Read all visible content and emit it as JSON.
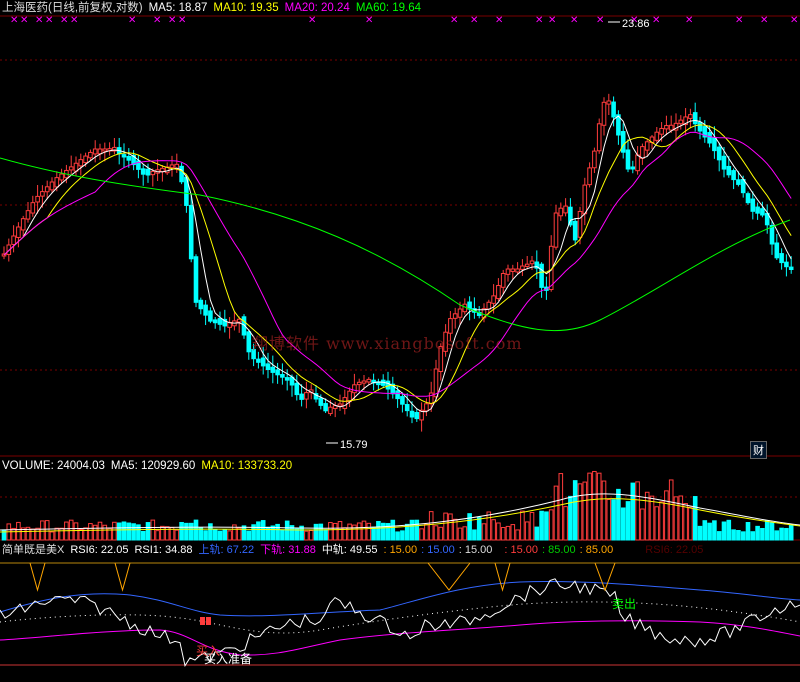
{
  "main_legend": {
    "title": "上海医药(日线,前复权,对数)",
    "ma5": "MA5: 18.87",
    "ma10": "MA10: 19.35",
    "ma20": "MA20: 20.24",
    "ma60": "MA60: 19.64"
  },
  "price_marks": {
    "high": "23.86",
    "low": "15.79"
  },
  "watermark": "翔博软件 www.xiangbosoft.com",
  "finance_tag": "财",
  "volume_legend": {
    "volume": "VOLUME: 24004.03",
    "ma5": "MA5: 120929.60",
    "ma10": "MA10: 133733.20"
  },
  "indicator_legend": {
    "name": "简单既是美X",
    "rsi6": "RSI6: 22.05",
    "rsi1": "RSI1: 34.88",
    "upper": "上轨: 67.22",
    "lower": "下轨: 31.88",
    "middle": "中轨: 49.55",
    "v1": ": 15.00",
    "v2": ": 15.00",
    "v3": ": 15.00",
    "v4": ": 15.00",
    "v5": ": 85.00",
    "v6": ": 85.00",
    "ghost": "RSI6: 22.05"
  },
  "signals": {
    "sell": "卖出",
    "buy": "买入",
    "buy_prepare": "买入准备"
  },
  "colors": {
    "up": "#ff3c3c",
    "down": "#00ffff",
    "ma5": "#ffffff",
    "ma10": "#ffff00",
    "ma20": "#ff00ff",
    "ma60": "#00ff00",
    "grid": "#8b0000"
  }
}
